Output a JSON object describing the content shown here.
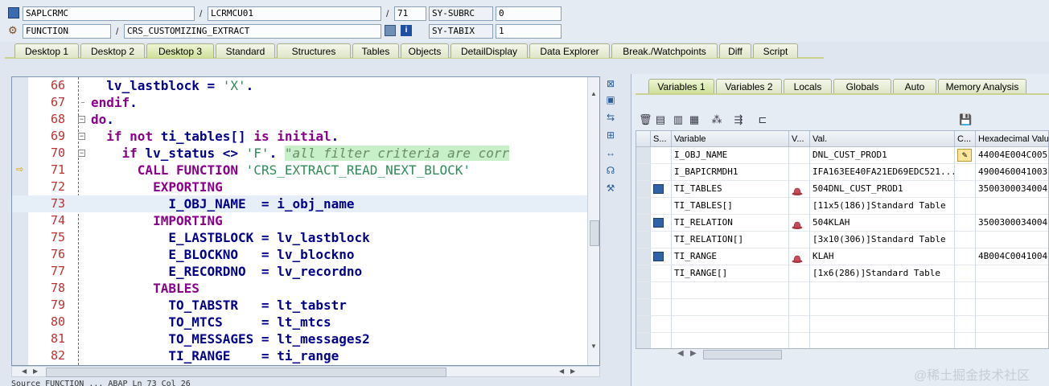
{
  "header": {
    "program": "SAPLCRMC",
    "include": "LCRMCU01",
    "line": "71",
    "sysubrc_label": "SY-SUBRC",
    "sysubrc_value": "0",
    "event_type": "FUNCTION",
    "event_name": "CRS_CUSTOMIZING_EXTRACT",
    "sytabix_label": "SY-TABIX",
    "sytabix_value": "1",
    "slash": "/"
  },
  "tabs": [
    "Desktop 1",
    "Desktop 2",
    "Desktop 3",
    "Standard",
    "Structures",
    "Tables",
    "Objects",
    "DetailDisplay",
    "Data Explorer",
    "Break./Watchpoints",
    "Diff",
    "Script"
  ],
  "active_tab": "Desktop 3",
  "code_lines": [
    {
      "num": "66",
      "text": "  lv_lastblock = 'X'."
    },
    {
      "num": "67",
      "text": "endif."
    },
    {
      "num": "68",
      "text": "do."
    },
    {
      "num": "69",
      "text": "  if not ti_tables[] is initial."
    },
    {
      "num": "70",
      "text": "    if lv_status <> 'F'. \"all filter criteria are corr"
    },
    {
      "num": "71",
      "text": "      CALL FUNCTION 'CRS_EXTRACT_READ_NEXT_BLOCK'"
    },
    {
      "num": "72",
      "text": "        EXPORTING"
    },
    {
      "num": "73",
      "text": "          I_OBJ_NAME  = i_obj_name"
    },
    {
      "num": "74",
      "text": "        IMPORTING"
    },
    {
      "num": "75",
      "text": "          E_LASTBLOCK = lv_lastblock"
    },
    {
      "num": "76",
      "text": "          E_BLOCKNO   = lv_blockno"
    },
    {
      "num": "77",
      "text": "          E_RECORDNO  = lv_recordno"
    },
    {
      "num": "78",
      "text": "        TABLES"
    },
    {
      "num": "79",
      "text": "          TO_TABSTR   = lt_tabstr"
    },
    {
      "num": "80",
      "text": "          TO_MTCS     = lt_mtcs"
    },
    {
      "num": "81",
      "text": "          TO_MESSAGES = lt_messages2"
    },
    {
      "num": "82",
      "text": "          TI_RANGE    = ti_range"
    }
  ],
  "status_bar": "Source  FUNCTION ... ABAP  Ln 73 Col 26",
  "right_tabs": [
    "Variables 1",
    "Variables 2",
    "Locals",
    "Globals",
    "Auto",
    "Memory Analysis"
  ],
  "right_active_tab": "Variables 1",
  "grid": {
    "columns": [
      "S...",
      "Variable",
      "V...",
      "Val.",
      "C...",
      "Hexadecimal Valu"
    ],
    "rows": [
      {
        "icon": "",
        "variable": "I_OBJ_NAME",
        "vicon": "",
        "value": "DNL_CUST_PROD1",
        "change": "pencil",
        "hex": "44004E004C005"
      },
      {
        "icon": "",
        "variable": "I_BAPICRMDH1",
        "vicon": "",
        "value": "IFA163EE40FA21ED69EDC521...",
        "change": "",
        "hex": "4900460041003"
      },
      {
        "icon": "table",
        "variable": "TI_TABLES",
        "vicon": "hat",
        "value": "504DNL_CUST_PROD1",
        "change": "",
        "hex": "3500300034004"
      },
      {
        "icon": "",
        "variable": "TI_TABLES[]",
        "vicon": "",
        "value": "[11x5(186)]Standard Table",
        "change": "",
        "hex": ""
      },
      {
        "icon": "table",
        "variable": "TI_RELATION",
        "vicon": "hat",
        "value": "504KLAH",
        "change": "",
        "hex": "3500300034004"
      },
      {
        "icon": "",
        "variable": "TI_RELATION[]",
        "vicon": "",
        "value": "[3x10(306)]Standard Table",
        "change": "",
        "hex": ""
      },
      {
        "icon": "table",
        "variable": "TI_RANGE",
        "vicon": "hat",
        "value": "KLAH",
        "change": "",
        "hex": "4B004C0041004"
      },
      {
        "icon": "",
        "variable": "TI_RANGE[]",
        "vicon": "",
        "value": "[1x6(286)]Standard Table",
        "change": "",
        "hex": ""
      }
    ]
  },
  "watermark": "@稀土掘金技术社区"
}
